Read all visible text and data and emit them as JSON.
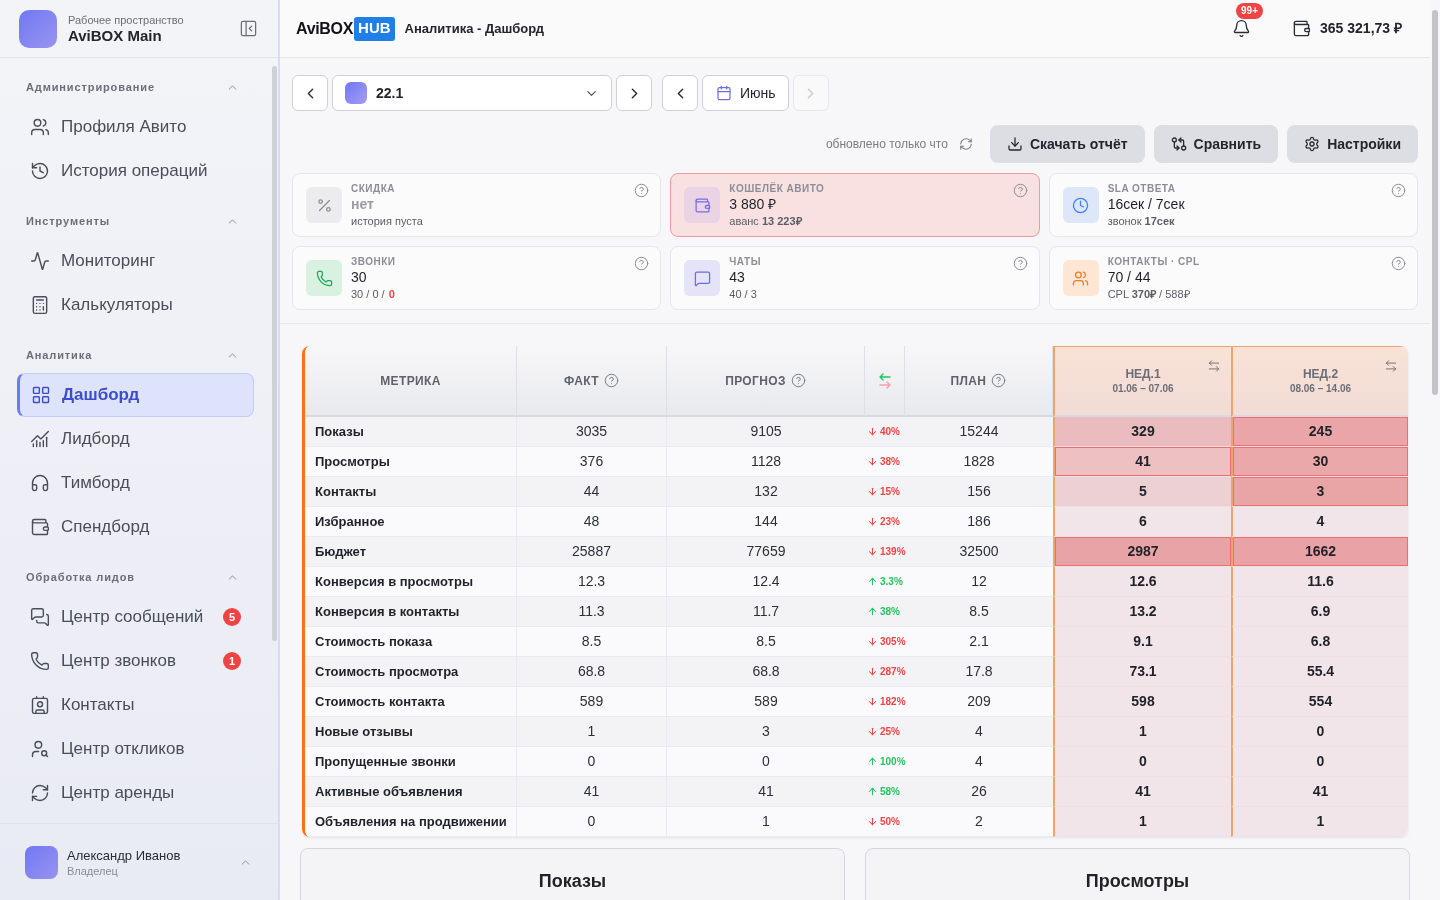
{
  "sidebar": {
    "workspace": {
      "caption": "Рабочее пространство",
      "name": "AviBOX Main"
    },
    "sections": [
      {
        "title": "Администрирование",
        "expanded": true,
        "items": [
          {
            "label": "Профиля Авито",
            "selected": false
          },
          {
            "label": "История операций",
            "selected": false
          }
        ]
      },
      {
        "title": "Инструменты",
        "expanded": true,
        "items": [
          {
            "label": "Мониторинг",
            "selected": false
          },
          {
            "label": "Калькуляторы",
            "selected": false
          }
        ]
      },
      {
        "title": "Аналитика",
        "expanded": true,
        "items": [
          {
            "label": "Дашборд",
            "selected": true
          },
          {
            "label": "Лидборд",
            "selected": false
          },
          {
            "label": "Тимборд",
            "selected": false
          },
          {
            "label": "Спендборд",
            "selected": false
          }
        ]
      },
      {
        "title": "Обработка лидов",
        "expanded": true,
        "items": [
          {
            "label": "Центр сообщений",
            "selected": false,
            "badge": "5"
          },
          {
            "label": "Центр звонков",
            "selected": false,
            "badge": "1"
          },
          {
            "label": "Контакты",
            "selected": false
          },
          {
            "label": "Центр откликов",
            "selected": false
          },
          {
            "label": "Центр аренды",
            "selected": false
          }
        ]
      }
    ],
    "user": {
      "name": "Александр Иванов",
      "role": "Владелец"
    }
  },
  "header": {
    "brand": {
      "name": "AviBOX",
      "tag": "HUB"
    },
    "title": "Аналитика - Дашборд",
    "notifications_badge": "99+",
    "balance": "365 321,73 ₽"
  },
  "toolbar": {
    "account": {
      "value": "22.1",
      "prev_disabled": false,
      "next_disabled": false
    },
    "month": {
      "value": "Июнь",
      "prev_disabled": false,
      "next_disabled": true
    },
    "status": "обновлено только что",
    "actions": [
      {
        "label": "Скачать отчёт"
      },
      {
        "label": "Сравнить"
      },
      {
        "label": "Настройки"
      }
    ]
  },
  "cards": [
    {
      "label": "СКИДКА",
      "value": "нет",
      "sub": "история пуста",
      "empty": true,
      "alert": false
    },
    {
      "label": "КОШЕЛЁК АВИТО",
      "value": "3 880 ₽",
      "sub": "аванс **13 223₽**",
      "empty": false,
      "alert": true
    },
    {
      "label": "SLA ОТВЕТА",
      "value": "16сек / 7сек",
      "sub": "звонок **17сек**",
      "empty": false,
      "alert": false
    },
    {
      "label": "ЗВОНКИ",
      "value": "30",
      "sub": "30 / 0 /",
      "sub_alert": "0",
      "empty": false,
      "alert": false
    },
    {
      "label": "ЧАТЫ",
      "value": "43",
      "sub": "40 / 3",
      "empty": false,
      "alert": false
    },
    {
      "label": "КОНТАКТЫ · CPL",
      "value": "70 / 44",
      "sub": "CPL **370₽** / 588₽",
      "empty": false,
      "alert": false
    }
  ],
  "table": {
    "columns": [
      {
        "kind": "text",
        "label": "МЕТРИКА",
        "help": false
      },
      {
        "kind": "text",
        "label": "ФАКТ",
        "help": true
      },
      {
        "kind": "text",
        "label": "ПРОГНОЗ",
        "help": true
      },
      {
        "kind": "delta"
      },
      {
        "kind": "text",
        "label": "ПЛАН",
        "help": true
      }
    ],
    "weeks": [
      {
        "label": "НЕД.1",
        "dates": "01.06 – 07.06"
      },
      {
        "label": "НЕД.2",
        "dates": "08.06 – 14.06"
      }
    ],
    "rows": [
      {
        "metric": "Показы",
        "fact": "3035",
        "forecast": "9105",
        "delta": {
          "rising": false,
          "text": "40%"
        },
        "plan": "15244",
        "weeks": [
          {
            "value": "329",
            "color": "#ebbcbf",
            "flagged": false
          },
          {
            "value": "245",
            "color": "#e9a5a8",
            "flagged": true
          }
        ]
      },
      {
        "metric": "Просмотры",
        "fact": "376",
        "forecast": "1128",
        "delta": {
          "rising": false,
          "text": "38%"
        },
        "plan": "1828",
        "weeks": [
          {
            "value": "41",
            "color": "#efc0c2",
            "flagged": true
          },
          {
            "value": "30",
            "color": "#eba8aa",
            "flagged": true
          }
        ]
      },
      {
        "metric": "Контакты",
        "fact": "44",
        "forecast": "132",
        "delta": {
          "rising": false,
          "text": "15%"
        },
        "plan": "156",
        "weeks": [
          {
            "value": "5",
            "color": "#edd0d4",
            "flagged": false
          },
          {
            "value": "3",
            "color": "#e9a4a6",
            "flagged": true
          }
        ]
      },
      {
        "metric": "Избранное",
        "fact": "48",
        "forecast": "144",
        "delta": {
          "rising": false,
          "text": "23%"
        },
        "plan": "186",
        "weeks": [
          {
            "value": "6",
            "color": "#f1e5e9",
            "flagged": false
          },
          {
            "value": "4",
            "color": "#f1e5e9",
            "flagged": false
          }
        ]
      },
      {
        "metric": "Бюджет",
        "fact": "25887",
        "forecast": "77659",
        "delta": {
          "rising": false,
          "text": "139%"
        },
        "plan": "32500",
        "weeks": [
          {
            "value": "2987",
            "color": "#e8a3a6",
            "flagged": true
          },
          {
            "value": "1662",
            "color": "#e9a3a6",
            "flagged": true
          }
        ]
      },
      {
        "metric": "Конверсия в просмотры",
        "fact": "12.3",
        "forecast": "12.4",
        "delta": {
          "rising": true,
          "text": "3.3%"
        },
        "plan": "12",
        "weeks": [
          {
            "value": "12.6",
            "color": "#f1e5e9",
            "flagged": false
          },
          {
            "value": "11.6",
            "color": "#f1e5e9",
            "flagged": false
          }
        ]
      },
      {
        "metric": "Конверсия в контакты",
        "fact": "11.3",
        "forecast": "11.7",
        "delta": {
          "rising": true,
          "text": "38%"
        },
        "plan": "8.5",
        "weeks": [
          {
            "value": "13.2",
            "color": "#f1e5e9",
            "flagged": false
          },
          {
            "value": "6.9",
            "color": "#f1e5e9",
            "flagged": false
          }
        ]
      },
      {
        "metric": "Стоимость показа",
        "fact": "8.5",
        "forecast": "8.5",
        "delta": {
          "rising": false,
          "text": "305%"
        },
        "plan": "2.1",
        "weeks": [
          {
            "value": "9.1",
            "color": "#f1e5e9",
            "flagged": false
          },
          {
            "value": "6.8",
            "color": "#f1e5e9",
            "flagged": false
          }
        ]
      },
      {
        "metric": "Стоимость просмотра",
        "fact": "68.8",
        "forecast": "68.8",
        "delta": {
          "rising": false,
          "text": "287%"
        },
        "plan": "17.8",
        "weeks": [
          {
            "value": "73.1",
            "color": "#f1e5e9",
            "flagged": false
          },
          {
            "value": "55.4",
            "color": "#f1e5e9",
            "flagged": false
          }
        ]
      },
      {
        "metric": "Стоимость контакта",
        "fact": "589",
        "forecast": "589",
        "delta": {
          "rising": false,
          "text": "182%"
        },
        "plan": "209",
        "weeks": [
          {
            "value": "598",
            "color": "#f1e5e9",
            "flagged": false
          },
          {
            "value": "554",
            "color": "#f1e5e9",
            "flagged": false
          }
        ]
      },
      {
        "metric": "Новые отзывы",
        "fact": "1",
        "forecast": "3",
        "delta": {
          "rising": false,
          "text": "25%"
        },
        "plan": "4",
        "weeks": [
          {
            "value": "1",
            "color": "#f1e5e9",
            "flagged": false
          },
          {
            "value": "0",
            "color": "#f1e5e9",
            "flagged": false
          }
        ]
      },
      {
        "metric": "Пропущенные звонки",
        "fact": "0",
        "forecast": "0",
        "delta": {
          "rising": true,
          "text": "100%"
        },
        "plan": "4",
        "weeks": [
          {
            "value": "0",
            "color": "#f1e5e9",
            "flagged": false
          },
          {
            "value": "0",
            "color": "#f1e5e9",
            "flagged": false
          }
        ]
      },
      {
        "metric": "Активные объявления",
        "fact": "41",
        "forecast": "41",
        "delta": {
          "rising": true,
          "text": "58%"
        },
        "plan": "26",
        "weeks": [
          {
            "value": "41",
            "color": "#f1e5e9",
            "flagged": false
          },
          {
            "value": "41",
            "color": "#f1e5e9",
            "flagged": false
          }
        ]
      },
      {
        "metric": "Объявления на продвижении",
        "fact": "0",
        "forecast": "1",
        "delta": {
          "rising": false,
          "text": "50%"
        },
        "plan": "2",
        "weeks": [
          {
            "value": "1",
            "color": "#f1e5e9",
            "flagged": false
          },
          {
            "value": "1",
            "color": "#f1e5e9",
            "flagged": false
          }
        ]
      }
    ]
  },
  "charts": [
    {
      "title": "Показы"
    },
    {
      "title": "Просмотры"
    }
  ]
}
